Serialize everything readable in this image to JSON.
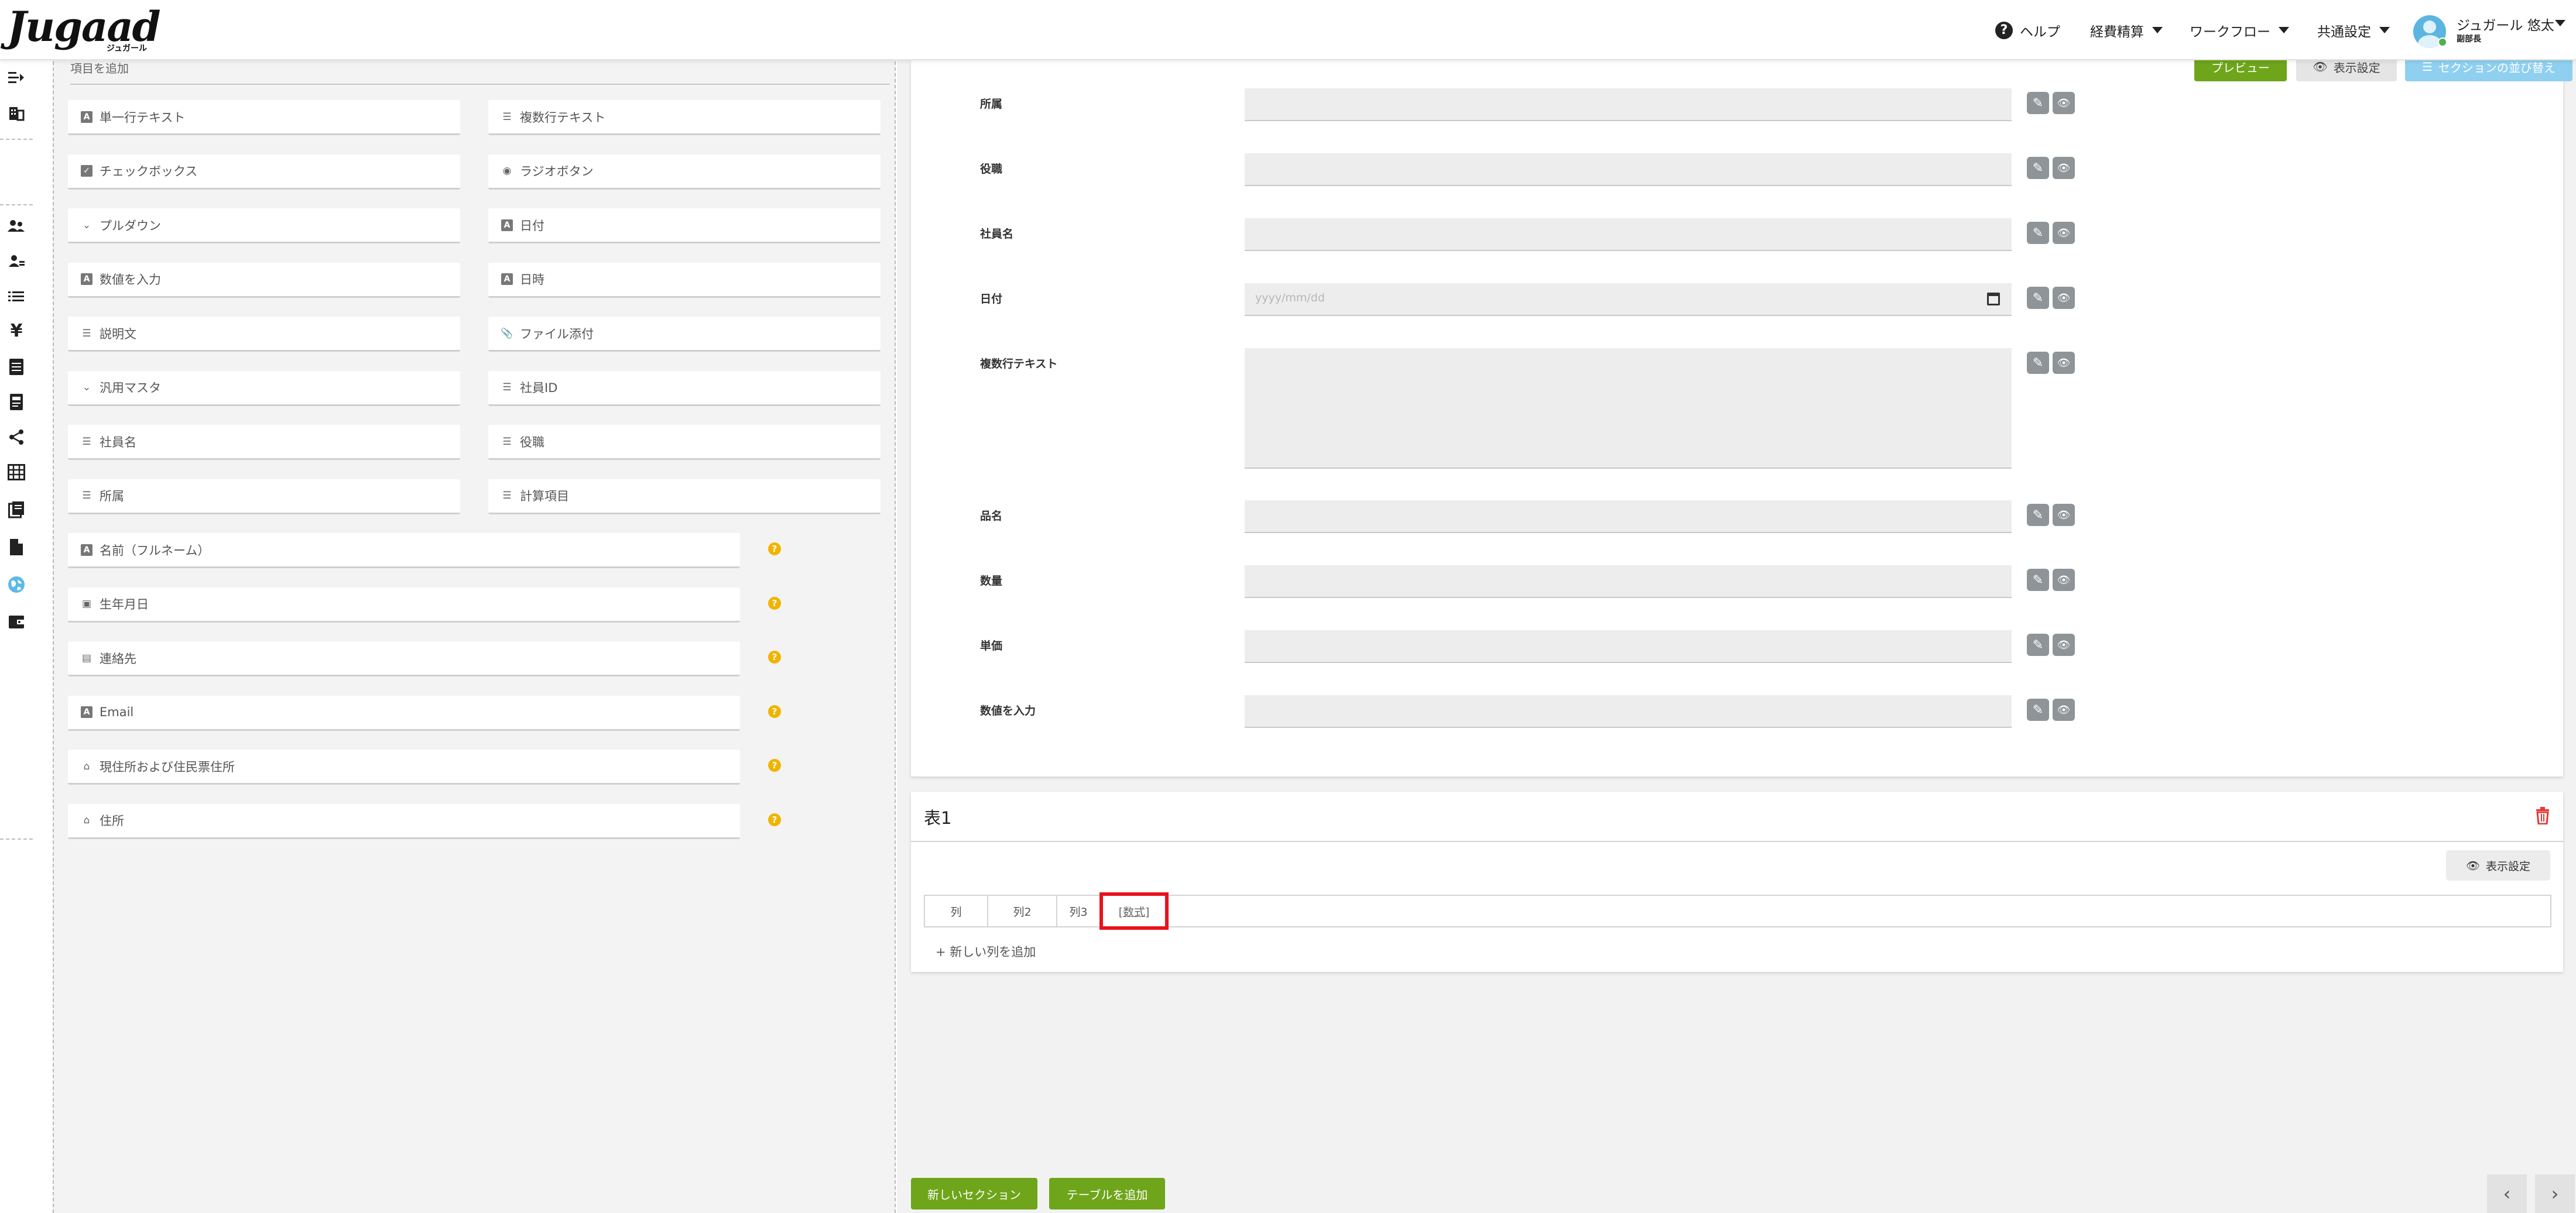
{
  "header": {
    "logo": "Jugaad",
    "logo_sub": "ジュガール",
    "nav": {
      "help": "ヘルプ",
      "expense": "経費精算",
      "workflow": "ワークフロー",
      "common_settings": "共通設定"
    },
    "user": {
      "name": "ジュガール 悠太",
      "role": "副部長"
    }
  },
  "rail": {
    "icons": [
      "collapse-icon",
      "building-icon",
      "users-icon",
      "user-group-icon",
      "list-icon",
      "yen-icon",
      "document-list-icon",
      "receipt-icon",
      "share-icon",
      "table-icon",
      "book-icon",
      "file-icon",
      "globe-icon",
      "wallet-icon"
    ]
  },
  "palette": {
    "title": "項目を追加",
    "left_items": [
      {
        "icon": "text-box-icon",
        "label": "単一行テキスト"
      },
      {
        "icon": "checkbox-icon",
        "label": "チェックボックス"
      },
      {
        "icon": "chevron-down-icon",
        "label": "プルダウン"
      },
      {
        "icon": "text-box-icon",
        "label": "数値を入力"
      },
      {
        "icon": "paragraph-icon",
        "label": "説明文"
      },
      {
        "icon": "chevron-down-icon",
        "label": "汎用マスタ"
      },
      {
        "icon": "paragraph-icon",
        "label": "社員名"
      },
      {
        "icon": "paragraph-icon",
        "label": "所属"
      }
    ],
    "right_items": [
      {
        "icon": "paragraph-icon",
        "label": "複数行テキスト"
      },
      {
        "icon": "radio-icon",
        "label": "ラジオボタン"
      },
      {
        "icon": "text-box-icon",
        "label": "日付"
      },
      {
        "icon": "text-box-icon",
        "label": "日時"
      },
      {
        "icon": "paperclip-icon",
        "label": "ファイル添付"
      },
      {
        "icon": "paragraph-icon",
        "label": "社員ID"
      },
      {
        "icon": "paragraph-icon",
        "label": "役職"
      },
      {
        "icon": "paragraph-icon",
        "label": "計算項目"
      }
    ],
    "wide_items": [
      {
        "icon": "text-box-icon",
        "label": "名前（フルネーム）"
      },
      {
        "icon": "calendar-icon",
        "label": "生年月日"
      },
      {
        "icon": "contact-icon",
        "label": "連絡先"
      },
      {
        "icon": "text-box-icon",
        "label": "Email"
      },
      {
        "icon": "address-icon",
        "label": "現住所および住民票住所"
      },
      {
        "icon": "address-icon",
        "label": "住所"
      }
    ]
  },
  "builder": {
    "top_buttons": {
      "preview": "プレビュー",
      "display": "表示設定",
      "reorder": "セクションの並び替え"
    },
    "fields": [
      {
        "label": "所属",
        "type": "text"
      },
      {
        "label": "役職",
        "type": "text"
      },
      {
        "label": "社員名",
        "type": "text"
      },
      {
        "label": "日付",
        "type": "date",
        "placeholder": "yyyy/mm/dd"
      },
      {
        "label": "複数行テキスト",
        "type": "textarea"
      },
      {
        "label": "品名",
        "type": "text"
      },
      {
        "label": "数量",
        "type": "text"
      },
      {
        "label": "単価",
        "type": "text"
      },
      {
        "label": "数値を入力",
        "type": "text"
      }
    ],
    "table": {
      "title": "表1",
      "display_button": "表示設定",
      "columns": [
        "列",
        "列2",
        "列3"
      ],
      "formula_link": "[数式]",
      "add_column": "新しい列を追加"
    },
    "bottom_buttons": {
      "new_section": "新しいセクション",
      "add_table": "テーブルを追加"
    }
  },
  "colors": {
    "accent_green": "#6ea51a",
    "accent_blue": "#5bb9ea",
    "highlight_red": "#e8121e",
    "help_yellow": "#f0b400"
  }
}
